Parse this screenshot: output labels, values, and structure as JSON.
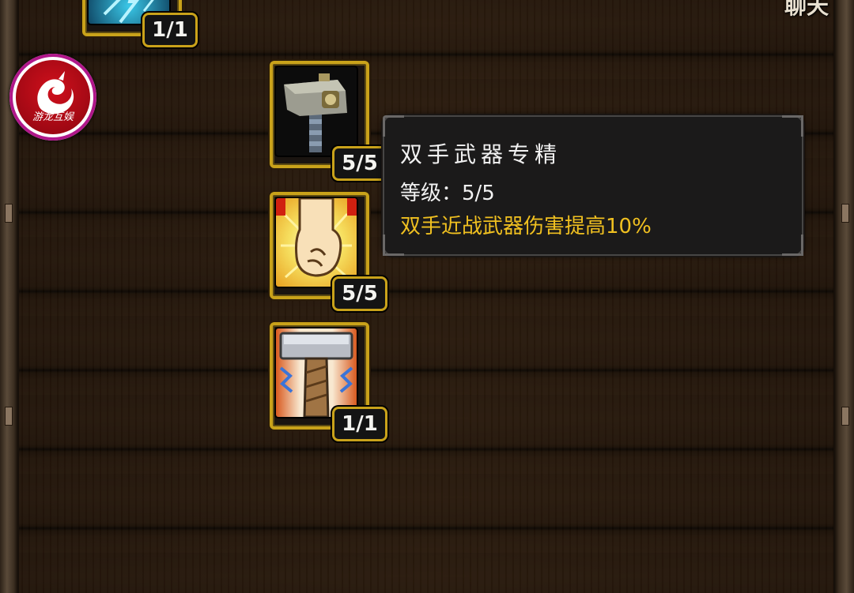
{
  "corner_label": "聊天",
  "logo": {
    "text": "游龙互娱"
  },
  "skills": [
    {
      "id": "lightning-skill",
      "level": "1/1"
    },
    {
      "id": "hammer-skill",
      "level": "5/5"
    },
    {
      "id": "fist-skill",
      "level": "5/5"
    },
    {
      "id": "thor-hammer-skill",
      "level": "1/1"
    }
  ],
  "tooltip": {
    "title": "双手武器专精",
    "level_label": "等级：5/5",
    "description": "双手近战武器伤害提高10%"
  },
  "colors": {
    "frame_gold": "#c9a21a",
    "tooltip_bg": "#1b1a1a",
    "desc_yellow": "#f0c020"
  }
}
